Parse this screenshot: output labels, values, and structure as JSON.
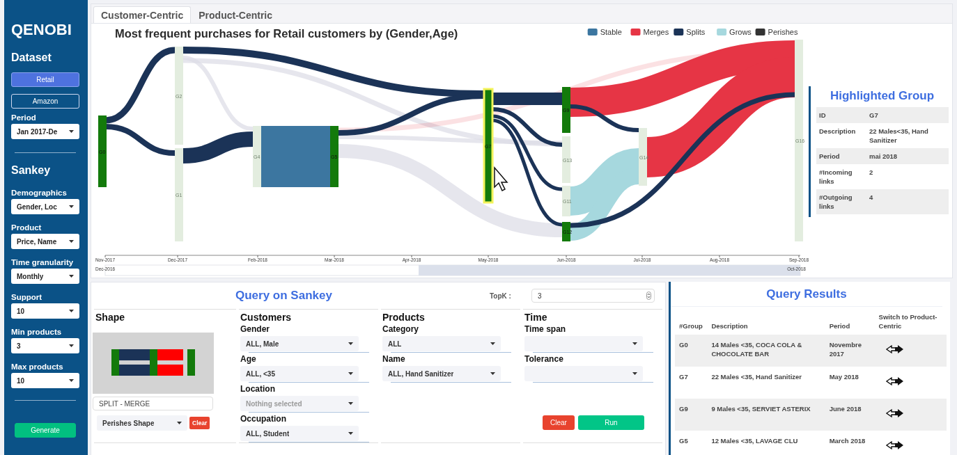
{
  "sidebar": {
    "logo": "QENOBI",
    "dataset_heading": "Dataset",
    "datasets": [
      {
        "label": "Retail",
        "selected": true
      },
      {
        "label": "Amazon",
        "selected": false
      }
    ],
    "dataset_fields": [
      {
        "label": "Period",
        "value": "Jan 2017-De"
      }
    ],
    "sankey_heading": "Sankey",
    "sankey_fields": [
      {
        "label": "Demographics",
        "value": "Gender, Loc"
      },
      {
        "label": "Product",
        "value": "Price, Name"
      },
      {
        "label": "Time granularity",
        "value": "Monthly"
      },
      {
        "label": "Support",
        "value": "10"
      },
      {
        "label": "Min products",
        "value": "3"
      },
      {
        "label": "Max products",
        "value": "10"
      }
    ],
    "generate_button": "Generate"
  },
  "tabs": [
    {
      "label": "Customer-Centric",
      "selected": true
    },
    {
      "label": "Product-Centric",
      "selected": false
    }
  ],
  "sankey": {
    "title": "Most frequent purchases for Retail customers by (Gender,Age)",
    "legend": [
      {
        "label": "Stable",
        "color": "#3c76a0"
      },
      {
        "label": "Merges",
        "color": "#e63545"
      },
      {
        "label": "Splits",
        "color": "#1b3357"
      },
      {
        "label": "Grows",
        "color": "#a6d8de"
      },
      {
        "label": "Perishes",
        "color": "#333333"
      }
    ],
    "nodes": [
      {
        "label": "G0",
        "active": true,
        "highlighted": false
      },
      {
        "label": "G2",
        "active": false,
        "highlighted": false
      },
      {
        "label": "G1",
        "active": false,
        "highlighted": false
      },
      {
        "label": "G4",
        "active": false,
        "highlighted": false
      },
      {
        "label": "G5",
        "active": true,
        "highlighted": false
      },
      {
        "label": "G7",
        "active": true,
        "highlighted": true
      },
      {
        "label": "G9",
        "active": true,
        "highlighted": false
      },
      {
        "label": "G13",
        "active": false,
        "highlighted": false
      },
      {
        "label": "G11",
        "active": false,
        "highlighted": false
      },
      {
        "label": "G12",
        "active": true,
        "highlighted": false
      },
      {
        "label": "G14",
        "active": false,
        "highlighted": false
      },
      {
        "label": "G16",
        "active": false,
        "highlighted": false
      }
    ],
    "x_ticks": [
      "Nov-2017",
      "Dec-2017",
      "Feb-2018",
      "Mar-2018",
      "Apr-2018",
      "May-2018",
      "Jun-2018",
      "Jul-2018",
      "Aug-2018",
      "Sep-2018"
    ],
    "range": {
      "start": "Dec-2016",
      "end": "Oct-2018",
      "level": 0.55
    }
  },
  "highlighted_group": {
    "title": "Highlighted Group",
    "rows": [
      {
        "label": "ID",
        "value": "G7"
      },
      {
        "label": "Description",
        "value": "22 Males<35, Hand Sanitizer"
      },
      {
        "label": "Period",
        "value": "mai 2018"
      },
      {
        "label": "#Incoming links",
        "value": "2"
      },
      {
        "label": "#Outgoing links",
        "value": "4"
      }
    ]
  },
  "query": {
    "title": "Query on Sankey",
    "topk_label": "TopK :",
    "topk_value": "3",
    "shape": {
      "heading": "Shape",
      "name": "SPLIT - MERGE",
      "perishes_select": "Perishes Shape",
      "clear_button": "Clear"
    },
    "groups": [
      {
        "heading": "Customers",
        "fields": [
          {
            "label": "Gender",
            "value": "ALL, Male"
          },
          {
            "label": "Age",
            "value": "ALL, <35"
          },
          {
            "label": "Location",
            "placeholder": "Nothing selected"
          },
          {
            "label": "Occupation",
            "value": "ALL, Student"
          }
        ]
      },
      {
        "heading": "Products",
        "fields": [
          {
            "label": "Category",
            "value": "ALL"
          },
          {
            "label": "Name",
            "value": "ALL, Hand Sanitizer"
          }
        ]
      },
      {
        "heading": "Time",
        "fields": [
          {
            "label": "Time span"
          },
          {
            "label": "Tolerance"
          }
        ]
      }
    ],
    "clear_button": "Clear",
    "run_button": "Run"
  },
  "results": {
    "title": "Query Results",
    "columns": [
      "#Group",
      "Description",
      "Period",
      "Switch to Product-Centric"
    ],
    "rows": [
      {
        "group": "G0",
        "description": "14 Males <35, COCA COLA & CHOCOLATE BAR",
        "period": "Novembre 2017"
      },
      {
        "group": "G7",
        "description": "22 Males <35, Hand Sanitizer",
        "period": "May 2018"
      },
      {
        "group": "G9",
        "description": "9 Males <35, SERVIET ASTERIX",
        "period": "June 2018"
      },
      {
        "group": "G5",
        "description": "12 Males <35, LAVAGE CLU",
        "period": "March 2018"
      }
    ]
  }
}
